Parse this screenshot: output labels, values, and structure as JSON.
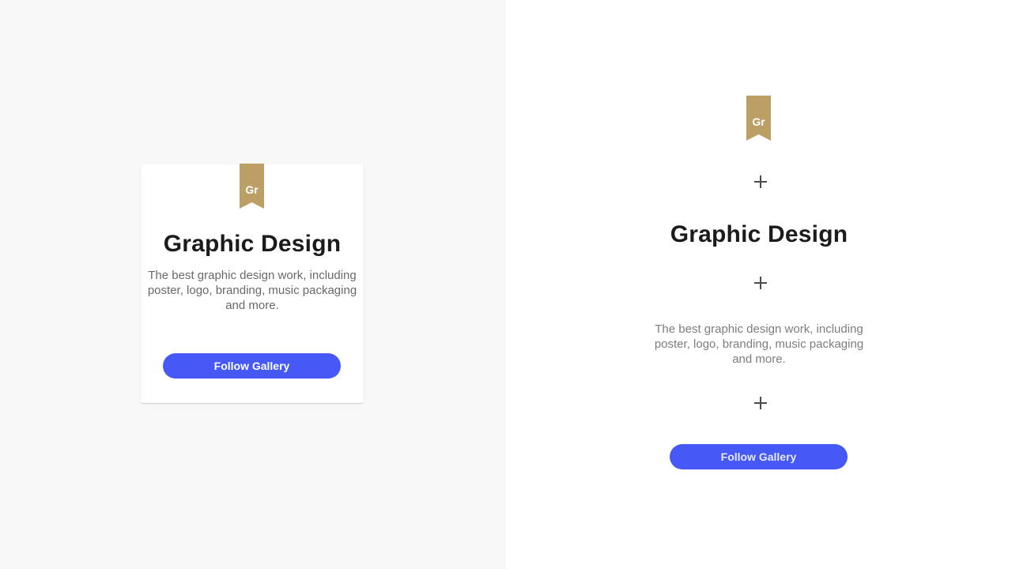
{
  "card": {
    "badge_text": "Gr",
    "title": "Graphic Design",
    "description": "The best graphic design work, including poster, logo, branding, music packaging and more.",
    "button_label": "Follow Gallery"
  },
  "exploded": {
    "badge_text": "Gr",
    "title": "Graphic Design",
    "description": "The best graphic design work, including poster, logo, branding, music packaging and more.",
    "button_label": "Follow Gallery"
  },
  "colors": {
    "badge": "#bb9f64",
    "button": "#4658f5",
    "left_background": "#f8f8f8",
    "right_background": "#ffffff"
  },
  "icons": {
    "plus": "plus-icon"
  }
}
